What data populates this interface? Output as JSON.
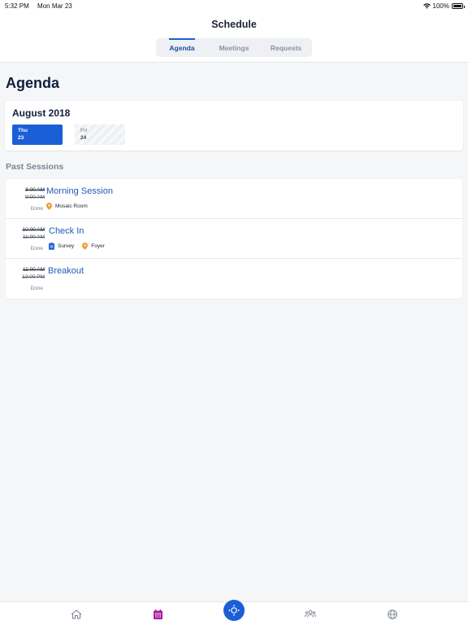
{
  "status_bar": {
    "time": "5:32 PM",
    "date": "Mon Mar 23",
    "battery": "100%"
  },
  "header": {
    "title": "Schedule",
    "tabs": [
      {
        "label": "Agenda",
        "active": true
      },
      {
        "label": "Meetings",
        "active": false
      },
      {
        "label": "Requests",
        "active": false
      }
    ]
  },
  "page": {
    "title": "Agenda"
  },
  "calendar": {
    "month": "August 2018",
    "days": [
      {
        "name": "Thu",
        "number": "23",
        "active": true
      },
      {
        "name": "Fri",
        "number": "24",
        "active": false
      }
    ]
  },
  "sessions_section": {
    "title": "Past Sessions",
    "sessions": [
      {
        "start": "8:00 AM",
        "end": "9:00 AM",
        "status": "Done",
        "name": "Morning Session",
        "meta": [
          {
            "icon": "location-pin-icon",
            "label": "Mosaic Room"
          }
        ]
      },
      {
        "start": "10:00 AM",
        "end": "11:00 AM",
        "status": "Done",
        "name": "Check In",
        "meta": [
          {
            "icon": "survey-icon",
            "label": "Survey"
          },
          {
            "icon": "location-pin-icon",
            "label": "Foyer"
          }
        ]
      },
      {
        "start": "11:00 AM",
        "end": "12:00 PM",
        "status": "Done",
        "name": "Breakout",
        "meta": []
      }
    ]
  },
  "tab_bar": {
    "items": [
      {
        "icon": "home-icon"
      },
      {
        "icon": "calendar-icon",
        "active": true
      },
      {
        "icon": "compass-icon"
      },
      {
        "icon": "people-icon"
      },
      {
        "icon": "globe-icon"
      }
    ]
  },
  "colors": {
    "accent": "#1b5fd6",
    "session_title": "#1d5cb8",
    "active_tab_icon": "#a3199b",
    "location_pin": "#f2962a"
  }
}
